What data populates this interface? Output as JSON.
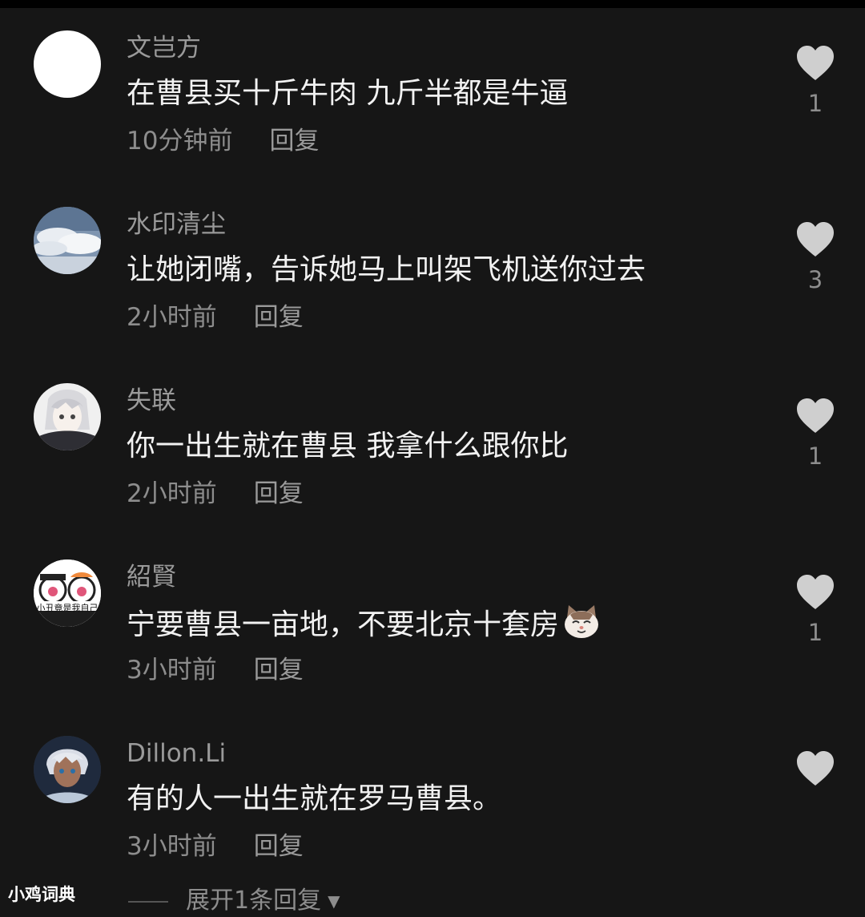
{
  "comments": [
    {
      "username": "文岂方",
      "text": "在曹县买十斤牛肉 九斤半都是牛逼",
      "time": "10分钟前",
      "reply": "回复",
      "likes": "1",
      "avatar": "white-circle-avatar"
    },
    {
      "username": "水印清尘",
      "text": "让她闭嘴，告诉她马上叫架飞机送你过去",
      "time": "2小时前",
      "reply": "回复",
      "likes": "3",
      "avatar": "sky-cloud-avatar"
    },
    {
      "username": "失联",
      "text": "你一出生就在曹县 我拿什么跟你比",
      "time": "2小时前",
      "reply": "回复",
      "likes": "1",
      "avatar": "anime-character-avatar"
    },
    {
      "username": "紹賢",
      "text": "宁要曹县一亩地，不要北京十套房",
      "time": "3小时前",
      "reply": "回复",
      "likes": "1",
      "avatar": "cartoon-duo-avatar",
      "avatar_caption": "小丑竟是我自己",
      "emoji": "cat-face-emoji"
    },
    {
      "username": "Dillon.Li",
      "text": "有的人一出生就在罗马曹县。",
      "time": "3小时前",
      "reply": "回复",
      "likes": "",
      "avatar": "anime-boy-avatar"
    }
  ],
  "expand_replies": "展开1条回复",
  "watermark": "小鸡词典",
  "colors": {
    "background": "#161616",
    "text": "#f2f2f2",
    "secondary": "#8d8d8d",
    "heart": "#cfcfcf"
  }
}
